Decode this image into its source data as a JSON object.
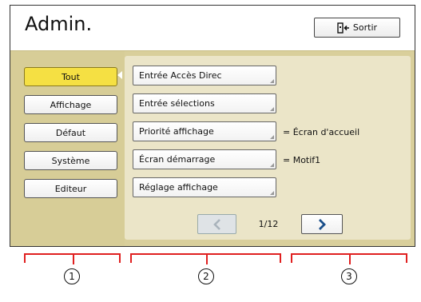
{
  "header": {
    "title": "Admin.",
    "exit_label": "Sortir"
  },
  "sidebar": {
    "items": [
      {
        "label": "Tout",
        "active": true
      },
      {
        "label": "Affichage",
        "active": false
      },
      {
        "label": "Défaut",
        "active": false
      },
      {
        "label": "Système",
        "active": false
      },
      {
        "label": "Editeur",
        "active": false
      }
    ]
  },
  "main": {
    "items": [
      {
        "label": "Entrée Accès Direc",
        "value": ""
      },
      {
        "label": "Entrée sélections",
        "value": ""
      },
      {
        "label": "Priorité affichage",
        "value": "= Écran d'accueil"
      },
      {
        "label": "Écran démarrage",
        "value": "= Motif1"
      },
      {
        "label": "Réglage affichage",
        "value": ""
      }
    ],
    "pager": {
      "page_text": "1/12",
      "prev_enabled": false,
      "next_enabled": true
    }
  },
  "callouts": [
    "1",
    "2",
    "3"
  ],
  "colors": {
    "active_tab": "#f5e043",
    "panel_bg": "#d9cf9b",
    "list_bg": "#ebe5c8",
    "callout_bracket": "#e02020",
    "next_arrow": "#1a4f8a"
  }
}
